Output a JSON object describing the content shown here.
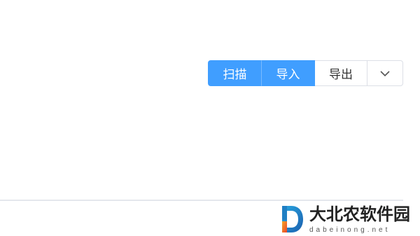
{
  "toolbar": {
    "scan_label": "扫描",
    "import_label": "导入",
    "export_label": "导出",
    "dropdown_icon": "chevron-down-icon",
    "primary_color": "#409eff"
  },
  "watermark": {
    "title": "大北农软件园",
    "url": "dabeinong.net",
    "logo_icon": "d-letter-logo"
  }
}
